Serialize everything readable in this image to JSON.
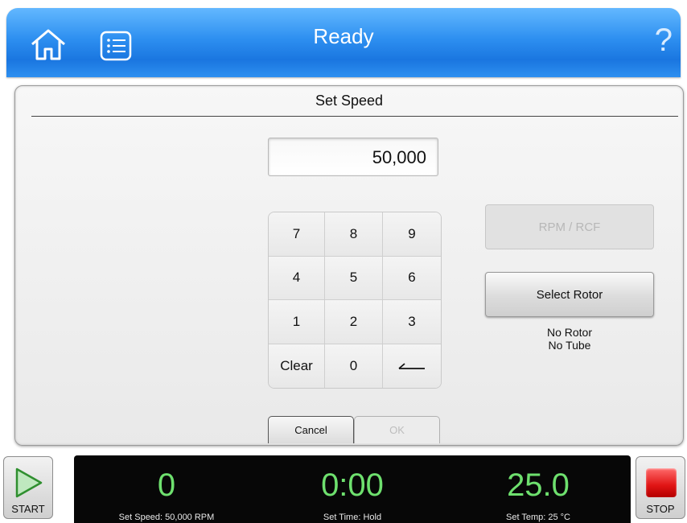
{
  "header": {
    "title": "Ready",
    "help_glyph": "?",
    "icons": [
      "home-icon",
      "list-icon",
      "help-icon"
    ],
    "colors": {
      "accent": "#2d8ff0"
    }
  },
  "panel": {
    "title": "Set Speed",
    "display_value": "50,000",
    "keypad": {
      "keys": [
        "7",
        "8",
        "9",
        "4",
        "5",
        "6",
        "1",
        "2",
        "3",
        "Clear",
        "0",
        "backspace"
      ]
    },
    "rpm_rcf_label": "RPM / RCF",
    "select_rotor_label": "Select Rotor",
    "rotor_status": "No Rotor",
    "tube_status": "No Tube",
    "cancel_label": "Cancel",
    "ok_label": "OK"
  },
  "bottom": {
    "start_label": "START",
    "stop_label": "STOP",
    "speed": {
      "value": "0",
      "label": "Set Speed: 50,000 RPM"
    },
    "time": {
      "value": "0:00",
      "label": "Set Time: Hold"
    },
    "temp": {
      "value": "25.0",
      "label": "Set Temp: 25 °C"
    },
    "colors": {
      "readout": "#6ee06e",
      "stop": "#e01414",
      "play": "#3fa83f"
    }
  }
}
